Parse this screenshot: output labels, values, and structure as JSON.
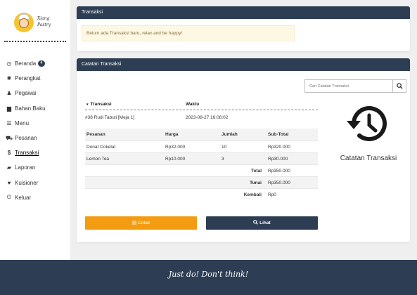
{
  "brand": {
    "line1": "Xiang",
    "line2": "Pastry"
  },
  "sidebar": {
    "items": [
      {
        "label": "Beranda",
        "icon": "clock-icon",
        "glyph": "◷",
        "badge": "4"
      },
      {
        "label": "Perangkat",
        "icon": "gear-icon",
        "glyph": "✱"
      },
      {
        "label": "Pegawai",
        "icon": "user-icon",
        "glyph": "♟"
      },
      {
        "label": "Bahan Baku",
        "icon": "archive-icon",
        "glyph": "▆"
      },
      {
        "label": "Menu",
        "icon": "list-icon",
        "glyph": "☰"
      },
      {
        "label": "Pesanan",
        "icon": "cart-icon",
        "glyph": "⛟"
      },
      {
        "label": "Transaksi",
        "icon": "dollar-icon",
        "glyph": "$",
        "active": true
      },
      {
        "label": "Laporan",
        "icon": "folder-icon",
        "glyph": "▰"
      },
      {
        "label": "Kuisioner",
        "icon": "heart-icon",
        "glyph": "♥"
      },
      {
        "label": "Keluar",
        "icon": "power-icon",
        "glyph": "⏻"
      }
    ]
  },
  "transaksi_panel": {
    "title": "Transaksi",
    "alert": "Belum ada Transaksi baru, relax and be happy!"
  },
  "catatan_panel": {
    "title": "Catatan Transaksi",
    "search_placeholder": "Cari Catatan Transaksi",
    "table": {
      "col_transaksi": "Transaksi",
      "col_waktu": "Waktu",
      "row": {
        "transaksi": "#38 Rudi Tabuti [Meja 1]",
        "waktu": "2023-08-27 16:08:02"
      }
    },
    "detail": {
      "headers": [
        "Pesanan",
        "Harga",
        "Jumlah",
        "Sub-Total"
      ],
      "rows": [
        {
          "pesanan": "Donat Cokelat",
          "harga": "Rp32.000",
          "jumlah": "10",
          "subtotal": "Rp320.000"
        },
        {
          "pesanan": "Lemon Tea",
          "harga": "Rp10.000",
          "jumlah": "3",
          "subtotal": "Rp30.000"
        }
      ],
      "total_label": "Total",
      "total_value": "Rp350.000",
      "tunai_label": "Tunai",
      "tunai_value": "Rp350.000",
      "kembali_label": "Kembali",
      "kembali_value": "Rp0"
    },
    "buttons": {
      "cetak": "Cetak",
      "lihat": "Lihat"
    },
    "side_label": "Catatan Transaksi"
  },
  "footer": {
    "text": "Just do! Don't think!"
  },
  "colors": {
    "navy": "#2d3e54",
    "orange": "#f39c12",
    "alert_bg": "#fcf8e3"
  }
}
